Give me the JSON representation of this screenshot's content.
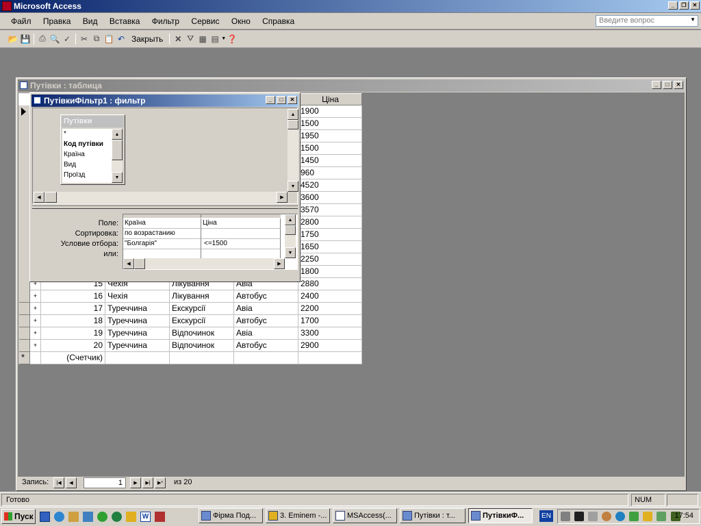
{
  "app": {
    "title": "Microsoft Access"
  },
  "menu": [
    "Файл",
    "Правка",
    "Вид",
    "Вставка",
    "Фильтр",
    "Сервис",
    "Окно",
    "Справка"
  ],
  "help_box": {
    "placeholder": "Введите вопрос"
  },
  "toolbar": {
    "close_label": "Закрыть"
  },
  "table_window": {
    "title": "Путівки : таблица",
    "price_header": "Ціна"
  },
  "table": {
    "hidden_prices": [
      "1900",
      "1500",
      "1950",
      "1500",
      "1450",
      "960",
      "4520",
      "3600",
      "3570",
      "2800",
      "1750",
      "1650",
      "2250",
      "1800"
    ],
    "partial_row": {
      "id": "15",
      "country": "Чехія",
      "type": "Лікування",
      "transport": "Авіа",
      "price": "2880"
    },
    "rows": [
      {
        "id": "16",
        "country": "Чехія",
        "type": "Лікування",
        "transport": "Автобус",
        "price": "2400"
      },
      {
        "id": "17",
        "country": "Туреччина",
        "type": "Екскурсії",
        "transport": "Авіа",
        "price": "2200"
      },
      {
        "id": "18",
        "country": "Туреччина",
        "type": "Екскурсії",
        "transport": "Автобус",
        "price": "1700"
      },
      {
        "id": "19",
        "country": "Туреччина",
        "type": "Відпочинок",
        "transport": "Авіа",
        "price": "3300"
      },
      {
        "id": "20",
        "country": "Туреччина",
        "type": "Відпочинок",
        "transport": "Автобус",
        "price": "2900"
      }
    ],
    "new_row": {
      "marker": "*",
      "id_placeholder": "(Счетчик)"
    }
  },
  "filter_window": {
    "title": "ПутівкиФільтр1 : фильтр",
    "field_list": {
      "title": "Путівки",
      "fields": [
        "*",
        "Код путівки",
        "Країна",
        "Вид",
        "Проїзд"
      ]
    },
    "grid": {
      "row_labels": [
        "Поле:",
        "Сортировка:",
        "Условие отбора:",
        "или:"
      ],
      "col1": {
        "field": "Країна",
        "sort": "по возрастанию",
        "criteria": "\"Болгарія\"",
        "or": ""
      },
      "col2": {
        "field": "Ціна",
        "sort": "",
        "criteria": "<=1500",
        "or": ""
      }
    }
  },
  "nav": {
    "label": "Запись:",
    "current": "1",
    "of_label": "из 20"
  },
  "status": {
    "text": "Готово",
    "num": "NUM"
  },
  "taskbar": {
    "start": "Пуск",
    "tasks": [
      "Фірма Под...",
      "3. Eminem -...",
      "MSAccess(...",
      "Путівки : т...",
      "ПутівкиФ..."
    ],
    "lang": "EN",
    "clock": "17:54"
  },
  "colors": {
    "title_active": "#0a246a",
    "title_active_end": "#a6caf0",
    "face": "#d4d0c8",
    "desktop_mdi": "#808080"
  }
}
